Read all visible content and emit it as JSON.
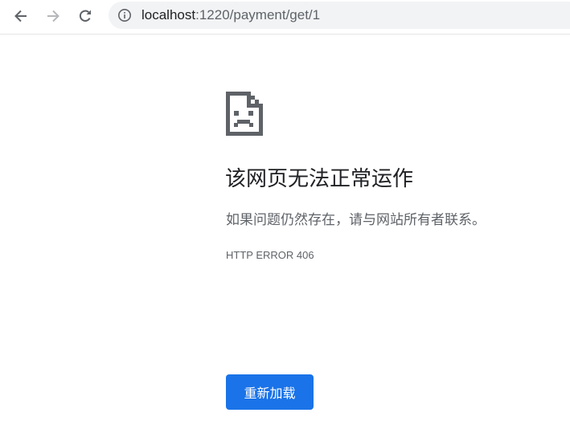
{
  "browser": {
    "url_host": "localhost",
    "url_rest": ":1220/payment/get/1",
    "icons": {
      "back": "arrow-left-icon",
      "forward": "arrow-right-icon",
      "reload": "reload-icon",
      "site_info": "info-icon"
    }
  },
  "error_page": {
    "icon": "sad-page-icon",
    "title": "该网页无法正常运作",
    "description": "如果问题仍然存在，请与网站所有者联系。",
    "code": "HTTP ERROR 406",
    "reload_label": "重新加载"
  },
  "colors": {
    "accent": "#1a73e8",
    "title_text": "#202124",
    "secondary_text": "#5f6368",
    "omnibox_bg": "#f1f3f4"
  }
}
